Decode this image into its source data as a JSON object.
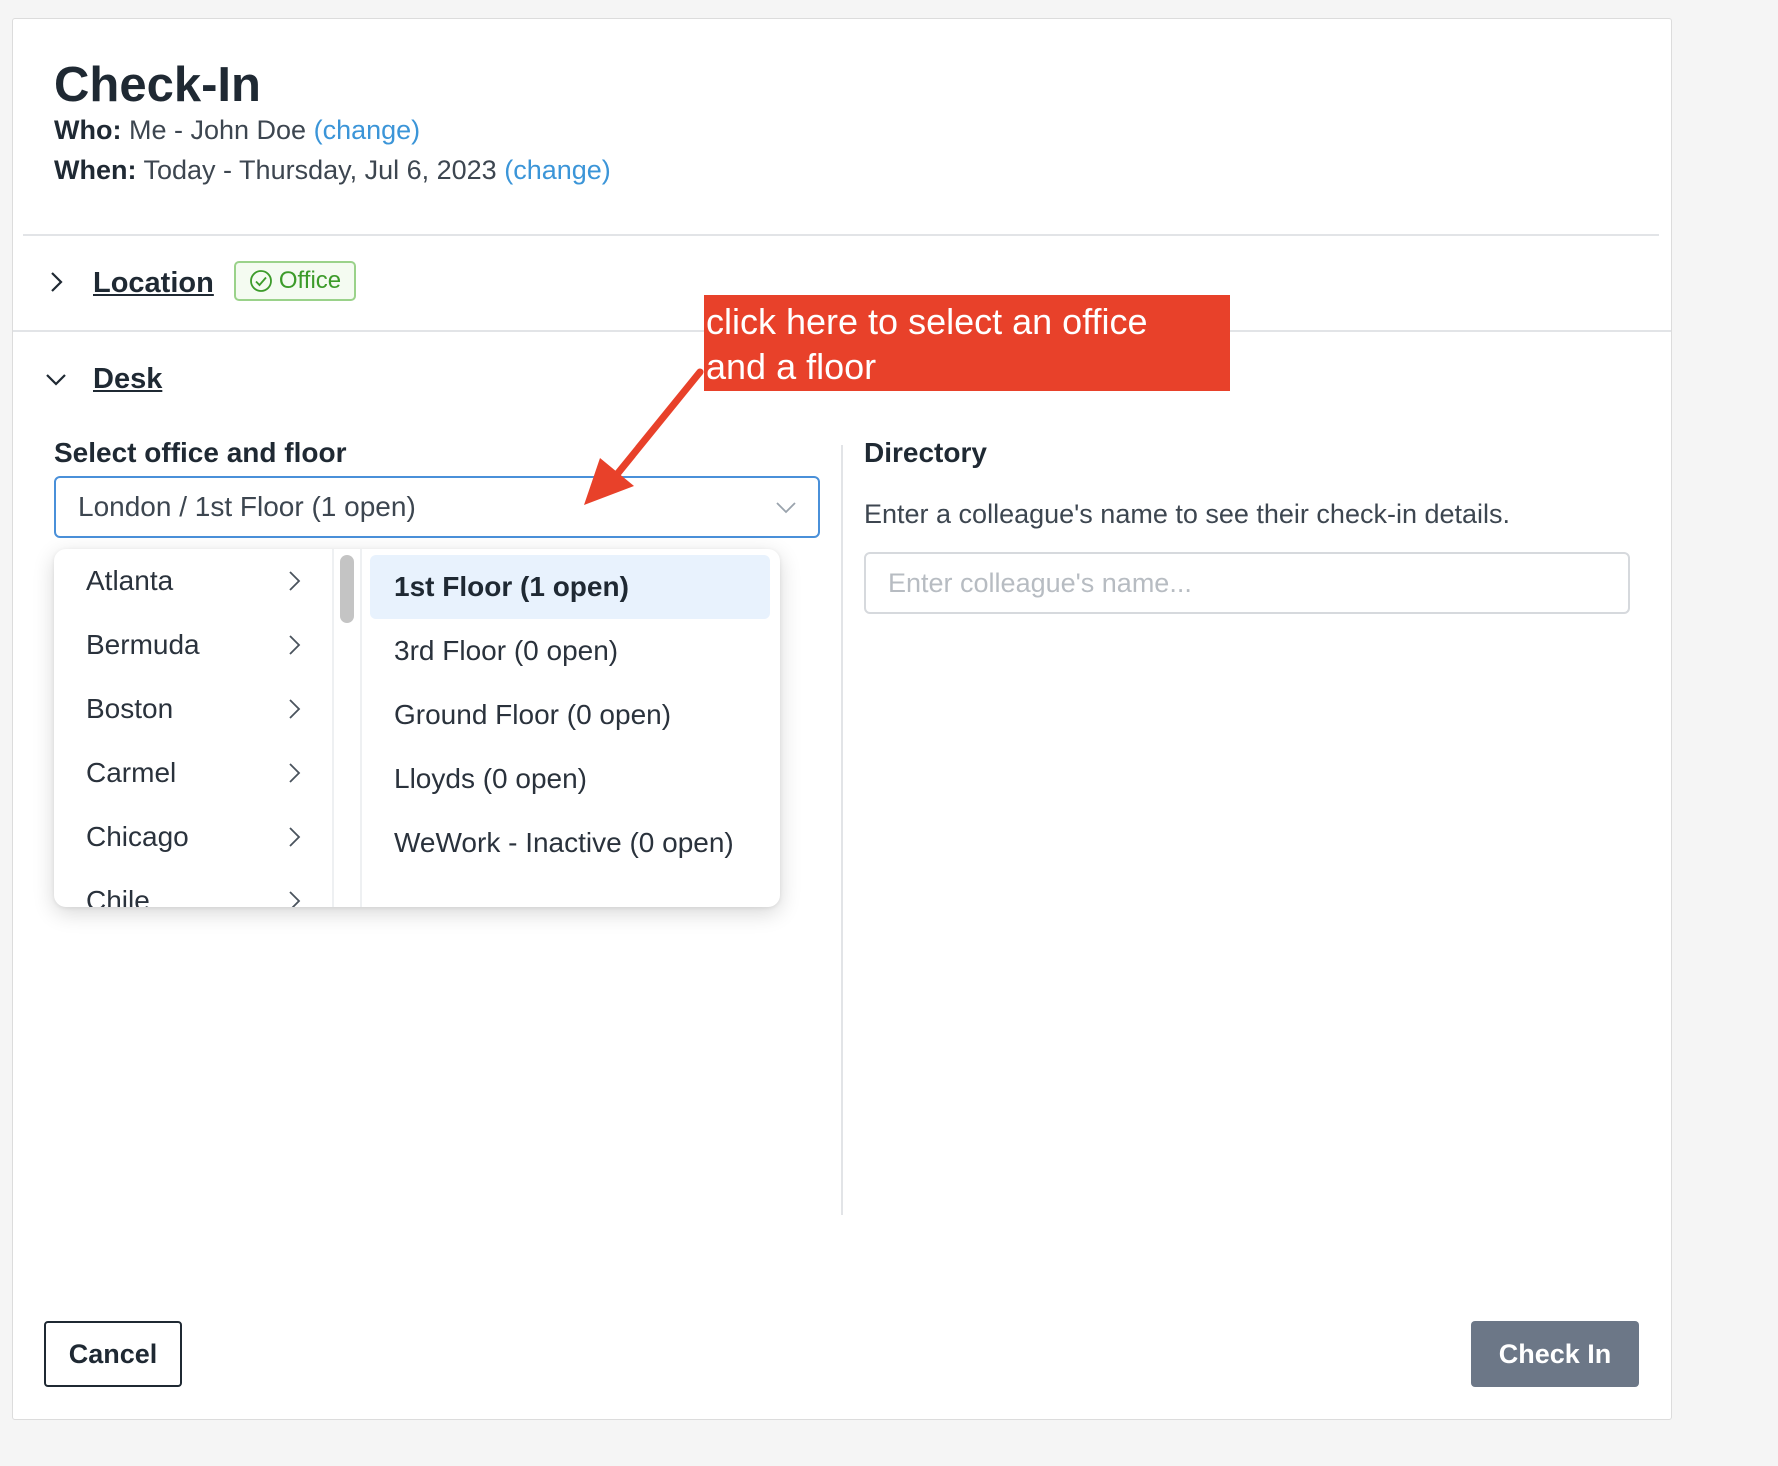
{
  "header": {
    "title": "Check-In",
    "who_label": "Who:",
    "who_value": "Me - John Doe",
    "who_change": "(change)",
    "when_label": "When:",
    "when_value": "Today - Thursday, Jul 6, 2023",
    "when_change": "(change)"
  },
  "location": {
    "label": "Location",
    "badge": "Office"
  },
  "desk": {
    "label": "Desk",
    "select_label": "Select office and floor",
    "select_value": "London / 1st Floor (1 open)",
    "cities": [
      "Atlanta",
      "Bermuda",
      "Boston",
      "Carmel",
      "Chicago",
      "Chile"
    ],
    "floors": [
      "1st Floor (1 open)",
      "3rd Floor (0 open)",
      "Ground Floor (0 open)",
      "Lloyds (0 open)",
      "WeWork - Inactive (0 open)"
    ],
    "selected_floor_index": 0
  },
  "directory": {
    "label": "Directory",
    "description": "Enter a colleague's name to see their check-in details.",
    "placeholder": "Enter colleague's name..."
  },
  "footer": {
    "cancel": "Cancel",
    "check_in": "Check In"
  },
  "annotation": {
    "line1": "click here to select an office",
    "line2": "and a floor",
    "color": "#e8412a"
  }
}
